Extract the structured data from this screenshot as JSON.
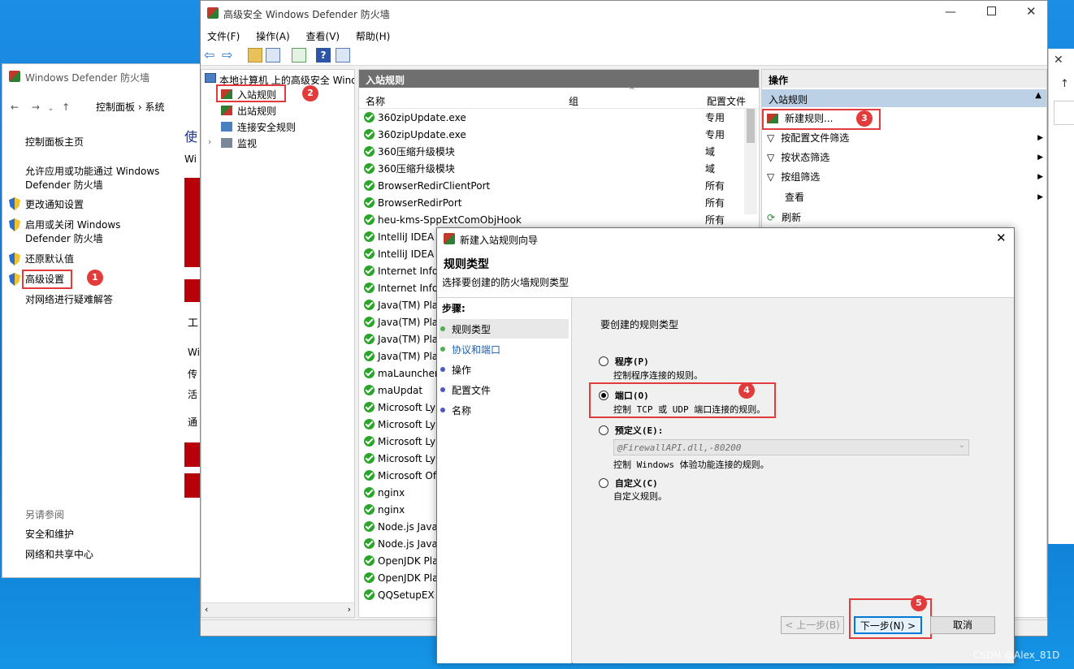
{
  "control_panel": {
    "title": "Windows Defender 防火墙",
    "address": "控制面板 › 系统",
    "links": {
      "home": "控制面板主页",
      "allow_app": "允许应用或功能通过 Windows\nDefender 防火墙",
      "notify": "更改通知设置",
      "toggle": "启用或关闭 Windows\nDefender 防火墙",
      "restore": "还原默认值",
      "advanced": "高级设置",
      "troubleshoot": "对网络进行疑难解答"
    },
    "see_also": "另请参阅",
    "security": "安全和维护",
    "network": "网络和共享中心",
    "partial_texts": [
      "使",
      "Wi",
      "工",
      "Wi",
      "传",
      "活",
      "通"
    ]
  },
  "mmc": {
    "title": "高级安全 Windows Defender 防火墙",
    "menu": [
      "文件(F)",
      "操作(A)",
      "查看(V)",
      "帮助(H)"
    ],
    "tree": {
      "root": "本地计算机 上的高级安全 Wind",
      "inbound": "入站规则",
      "outbound": "出站规则",
      "connection": "连接安全规则",
      "monitor": "监视"
    },
    "list": {
      "header": "入站规则",
      "col_name": "名称",
      "col_group": "组",
      "col_profile": "配置文件",
      "rows": [
        {
          "name": "360zipUpdate.exe",
          "profile": "专用"
        },
        {
          "name": "360zipUpdate.exe",
          "profile": "专用"
        },
        {
          "name": "360压缩升级模块",
          "profile": "域"
        },
        {
          "name": "360压缩升级模块",
          "profile": "域"
        },
        {
          "name": "BrowserRedirClientPort",
          "profile": "所有"
        },
        {
          "name": "BrowserRedirPort",
          "profile": "所有"
        },
        {
          "name": "heu-kms-SppExtComObjHook",
          "profile": "所有"
        },
        {
          "name": "IntelliJ IDEA",
          "profile": ""
        },
        {
          "name": "IntelliJ IDEA",
          "profile": ""
        },
        {
          "name": "Internet Info",
          "profile": ""
        },
        {
          "name": "Internet Info",
          "profile": ""
        },
        {
          "name": "Java(TM) Pla",
          "profile": ""
        },
        {
          "name": "Java(TM) Pla",
          "profile": ""
        },
        {
          "name": "Java(TM) Pla",
          "profile": ""
        },
        {
          "name": "Java(TM) Pla",
          "profile": ""
        },
        {
          "name": "maLauncher",
          "profile": ""
        },
        {
          "name": "maUpdat",
          "profile": ""
        },
        {
          "name": "Microsoft Ly",
          "profile": ""
        },
        {
          "name": "Microsoft Ly",
          "profile": ""
        },
        {
          "name": "Microsoft Ly",
          "profile": ""
        },
        {
          "name": "Microsoft Ly",
          "profile": ""
        },
        {
          "name": "Microsoft Of",
          "profile": ""
        },
        {
          "name": "nginx",
          "profile": ""
        },
        {
          "name": "nginx",
          "profile": ""
        },
        {
          "name": "Node.js Java",
          "profile": ""
        },
        {
          "name": "Node.js Java",
          "profile": ""
        },
        {
          "name": "OpenJDK Pla",
          "profile": ""
        },
        {
          "name": "OpenJDK Pla",
          "profile": ""
        },
        {
          "name": "QQSetupEX",
          "profile": ""
        }
      ]
    },
    "actions": {
      "header": "操作",
      "section": "入站规则",
      "new_rule": "新建规则...",
      "filter_profile": "按配置文件筛选",
      "filter_state": "按状态筛选",
      "filter_group": "按组筛选",
      "view": "查看",
      "refresh": "刷新"
    }
  },
  "wizard": {
    "title": "新建入站规则向导",
    "heading": "规则类型",
    "subheading": "选择要创建的防火墙规则类型",
    "steps_label": "步骤:",
    "steps": [
      "规则类型",
      "协议和端口",
      "操作",
      "配置文件",
      "名称"
    ],
    "prompt": "要创建的规则类型",
    "options": {
      "program": "程序(P)",
      "program_desc": "控制程序连接的规则。",
      "port": "端口(O)",
      "port_desc": "控制 TCP 或 UDP 端口连接的规则。",
      "predefined": "预定义(E):",
      "predefined_value": "@FirewallAPI.dll,-80200",
      "predefined_desc": "控制 Windows 体验功能连接的规则。",
      "custom": "自定义(C)",
      "custom_desc": "自定义规则。"
    },
    "buttons": {
      "back": "< 上一步(B)",
      "next": "下一步(N) >",
      "cancel": "取消"
    }
  },
  "badges": [
    "1",
    "2",
    "3",
    "4",
    "5"
  ],
  "watermark": "CSDN @Alex_81D",
  "colors": {
    "annotation_red": "#e23b3b",
    "rule_green": "#2aa52a",
    "pane_header": "#6f6f6f"
  }
}
